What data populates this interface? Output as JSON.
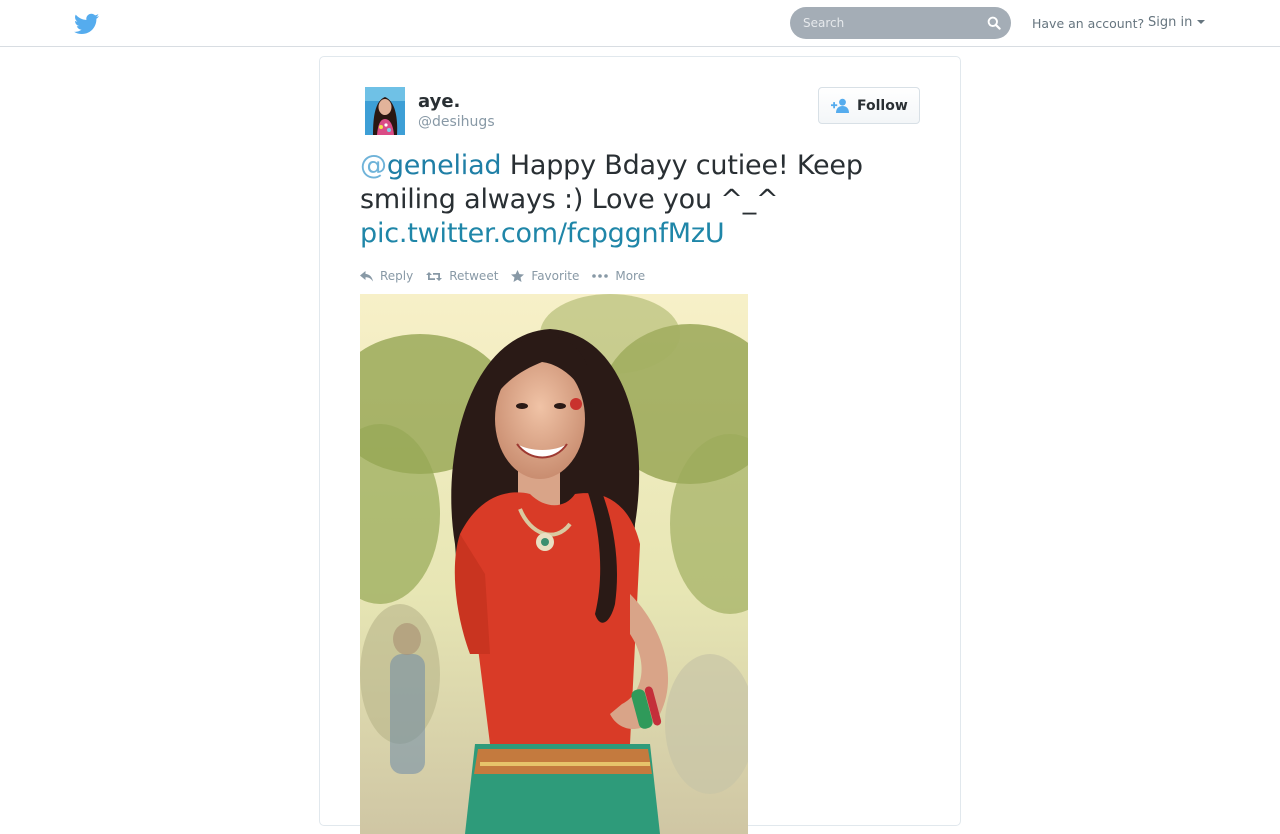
{
  "header": {
    "search_placeholder": "Search",
    "have_account": "Have an account?",
    "signin_label": "Sign in"
  },
  "tweet": {
    "fullname": "aye.",
    "username": "@desihugs",
    "follow_label": "Follow",
    "mention_at": "@",
    "mention_name": "geneliad",
    "text": " Happy Bdayy cutiee! Keep smiling always :) Love you ^_^",
    "pic_link": "pic.twitter.com/fcpggnfMzU",
    "actions": {
      "reply": "Reply",
      "retweet": "Retweet",
      "favorite": "Favorite",
      "more": "More"
    }
  },
  "colors": {
    "brand_blue": "#55acee",
    "link": "#1f86a8",
    "text": "#292f33",
    "muted": "#8899a6",
    "search_bg": "#a4adb6"
  },
  "icons": [
    "twitter-bird-icon",
    "search-icon",
    "caret-down-icon",
    "follow-user-icon",
    "reply-icon",
    "retweet-icon",
    "star-icon",
    "more-dots-icon"
  ]
}
